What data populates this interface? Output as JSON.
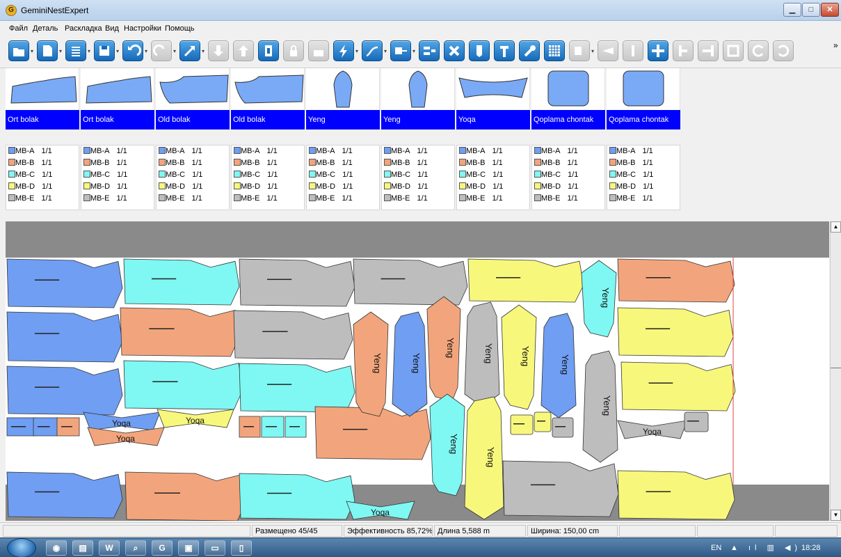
{
  "window": {
    "app_icon_letter": "G",
    "title": "GeminiNestExpert",
    "controls": [
      "minimize-icon",
      "maximize-icon",
      "close-icon"
    ]
  },
  "menu": [
    "Файл",
    "Деталь",
    "Раскладка",
    "Вид",
    "Настройки",
    "Помощь"
  ],
  "toolbar": {
    "overflow_label": "»",
    "buttons": [
      {
        "icon": "open-folder-icon",
        "enabled": true
      },
      {
        "icon": "open-file-icon",
        "enabled": true
      },
      {
        "icon": "list-icon",
        "enabled": true
      },
      {
        "icon": "save-icon",
        "enabled": true
      },
      {
        "icon": "undo-icon",
        "enabled": true
      },
      {
        "icon": "redo-icon",
        "enabled": false
      },
      {
        "icon": "auto-nest-icon",
        "enabled": true
      },
      {
        "icon": "move-down-icon",
        "enabled": false
      },
      {
        "icon": "move-up-icon",
        "enabled": false
      },
      {
        "icon": "lock-piece-icon",
        "enabled": true
      },
      {
        "icon": "lock-icon",
        "enabled": false
      },
      {
        "icon": "lock-all-icon",
        "enabled": false
      },
      {
        "icon": "flash-icon",
        "enabled": true
      },
      {
        "icon": "curve-icon",
        "enabled": true
      },
      {
        "icon": "cutter-icon",
        "enabled": true
      },
      {
        "icon": "align-icon",
        "enabled": true
      },
      {
        "icon": "delete-icon",
        "enabled": true
      },
      {
        "icon": "flip-vertical-icon",
        "enabled": true
      },
      {
        "icon": "flip-horizontal-icon",
        "enabled": true
      },
      {
        "icon": "settings-wrench-icon",
        "enabled": true
      },
      {
        "icon": "grid-icon",
        "enabled": true
      },
      {
        "icon": "group-icon",
        "enabled": false
      },
      {
        "icon": "split-icon",
        "enabled": false
      },
      {
        "icon": "marker-one-icon",
        "enabled": false
      },
      {
        "icon": "move-cross-icon",
        "enabled": true
      },
      {
        "icon": "align-left-icon",
        "enabled": false
      },
      {
        "icon": "align-right-icon",
        "enabled": false
      },
      {
        "icon": "frame-icon",
        "enabled": false
      },
      {
        "icon": "rotate-icon",
        "enabled": false
      },
      {
        "icon": "redo-small-icon",
        "enabled": false
      }
    ]
  },
  "pieces": [
    {
      "name": "Ort bolak",
      "shape": "ort"
    },
    {
      "name": "Ort bolak",
      "shape": "ort"
    },
    {
      "name": "Old bolak",
      "shape": "old"
    },
    {
      "name": "Old bolak",
      "shape": "old"
    },
    {
      "name": "Yeng",
      "shape": "yeng"
    },
    {
      "name": "Yeng",
      "shape": "yeng"
    },
    {
      "name": "Yoqa",
      "shape": "yoqa"
    },
    {
      "name": "Qoplama chontak",
      "shape": "pocket"
    },
    {
      "name": "Qoplama chontak",
      "shape": "pocket"
    }
  ],
  "sizes": [
    {
      "name": "MB-A",
      "qty": "1/1",
      "color": "#6f9ef2"
    },
    {
      "name": "MB-B",
      "qty": "1/1",
      "color": "#f2a57c"
    },
    {
      "name": "MB-C",
      "qty": "1/1",
      "color": "#7ff7f2"
    },
    {
      "name": "MB-D",
      "qty": "1/1",
      "color": "#f7f77c"
    },
    {
      "name": "MB-E",
      "qty": "1/1",
      "color": "#bdbdbd"
    }
  ],
  "marker": {
    "colors": {
      "A": "#6f9ef2",
      "B": "#f2a57c",
      "C": "#7ff7f2",
      "D": "#f7f77c",
      "E": "#bdbdbd"
    },
    "band_color": "#8a8a8a",
    "piece_text": {
      "yeng": "Yeng",
      "yoqa": "Yoqa"
    }
  },
  "status": {
    "placed": "Размещено 45/45",
    "efficiency": "Эффективность 85,72%",
    "length": "Длина 5,588 m",
    "width": "Ширина: 150,00 cm"
  },
  "taskbar": {
    "apps": [
      {
        "icon": "chrome-icon",
        "glyph": "◉"
      },
      {
        "icon": "explorer-icon",
        "glyph": "▤"
      },
      {
        "icon": "word-icon",
        "glyph": "W"
      },
      {
        "icon": "search-app-icon",
        "glyph": "⌕"
      },
      {
        "icon": "gemini-app-icon",
        "glyph": "G"
      },
      {
        "icon": "save-app-icon",
        "glyph": "▣"
      },
      {
        "icon": "window-app-icon",
        "glyph": "▭"
      },
      {
        "icon": "notes-app-icon",
        "glyph": "▯"
      }
    ],
    "language": "EN",
    "tray": "▲ ıl ▥ ◀)",
    "clock": "18:28"
  }
}
